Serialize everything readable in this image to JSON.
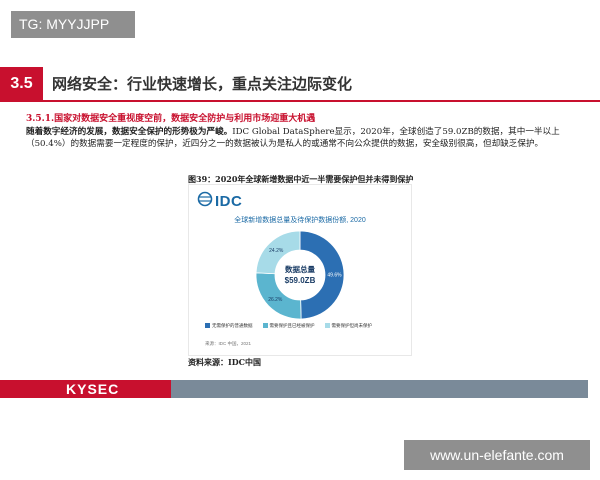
{
  "watermark_top": "TG: MYYJJPP",
  "section": {
    "number": "3.5",
    "title": "网络安全：行业快速增长，重点关注边际变化"
  },
  "subsection_title": "3.5.1.国家对数据安全重视度空前，数据安全防护与利用市场迎重大机遇",
  "paragraph": {
    "lead_bold": "随着数字经济的发展，数据安全保护的形势极为严峻。",
    "body": "IDC Global DataSphere显示，2020年，全球创造了59.0ZB的数据，其中一半以上（50.4%）的数据需要一定程度的保护，近四分之一的数据被认为是私人的或通常不向公众提供的数据，安全级别很高，但却缺乏保护。"
  },
  "figure_caption": "图39：2020年全球新增数据中近一半需要保护但并未得到保护",
  "figure": {
    "brand": "IDC",
    "title": "全球新增数据总量及待保护数据份额, 2020",
    "center_label": "数据总量",
    "center_value": "$59.0ZB",
    "source_inside": "来源：IDC 中国，2021"
  },
  "chart_data": {
    "type": "pie",
    "title": "全球新增数据总量及待保护数据份额, 2020",
    "categories": [
      "无需保护的普通数据",
      "需要保护且已经被保护",
      "需要保护但尚未保护"
    ],
    "values": [
      49.6,
      26.2,
      24.2
    ],
    "value_labels": [
      "49.6%",
      "26.2%",
      "24.2%"
    ],
    "colors": [
      "#2c6fb3",
      "#5bb5cf",
      "#a7dbe8"
    ],
    "legend_position": "bottom"
  },
  "source_note": "资料来源：IDC中国",
  "footer_logo": "KYSEC",
  "watermark_bottom": "www.un-elefante.com"
}
